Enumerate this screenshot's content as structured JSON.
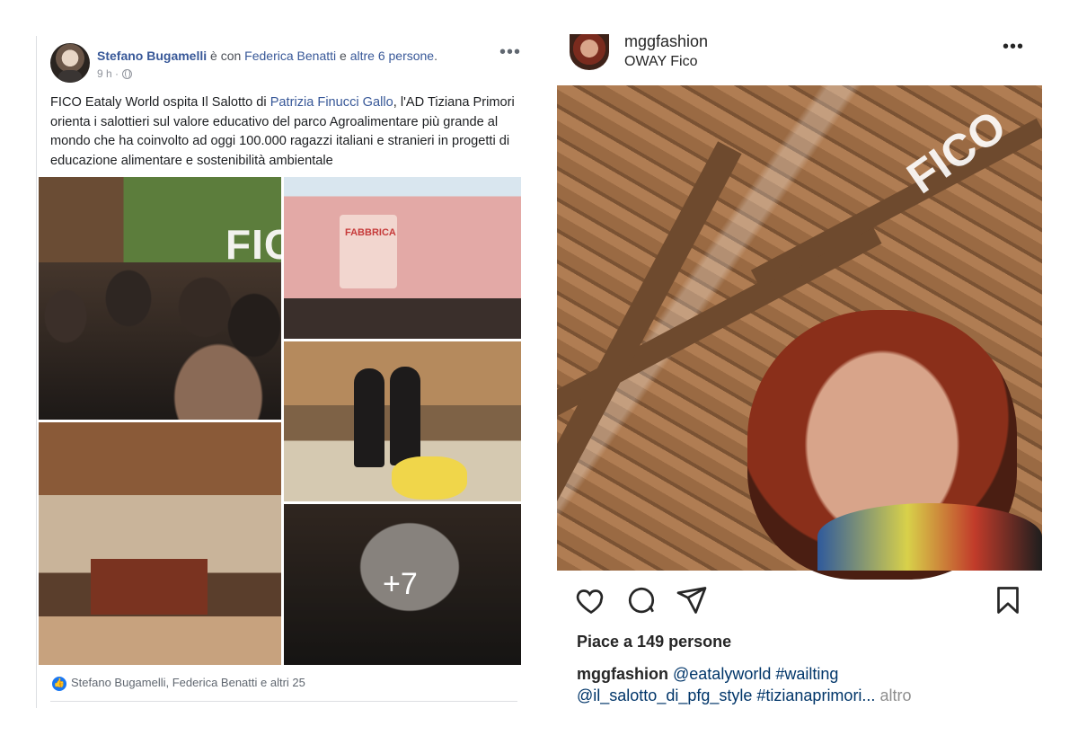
{
  "facebook_post": {
    "author": "Stefano Bugamelli",
    "with_text": "è con",
    "tagged_person": "Federica Benatti",
    "and_text": "e",
    "others_link": "altre 6 persone",
    "period": ".",
    "timestamp": "9 h ·",
    "more_icon": "more-horizontal-icon",
    "text_part1": "FICO Eataly World ospita Il Salotto di ",
    "text_mention": "Patrizia Finucci Gallo",
    "text_part2": ", l'AD Tiziana Primori orienta i salottieri sul valore educativo del parco Agroalimentare più grande al mondo che ha coinvolto ad oggi 100.000 ragazzi italiani e stranieri in progetti di educazione alimentare e sostenibilità ambientale",
    "photo_sign_fico": "FICO",
    "photo_sign_fabbrica": "FABBRICA",
    "more_photos": "+7",
    "reactions_text": "Stefano Bugamelli, Federica Benatti e altri 25"
  },
  "instagram_post": {
    "username": "mggfashion",
    "location": "OWAY Fico",
    "likes": "Piace a 149 persone",
    "caption_user": "mggfashion",
    "caption_tags_line1": "@eatalyworld #wailting",
    "caption_tags_line2": "@il_salotto_di_pfg_style #tizianaprimori...",
    "caption_more": "altro",
    "action_icons": [
      "heart-icon",
      "comment-icon",
      "share-icon",
      "bookmark-icon"
    ]
  },
  "colors": {
    "facebook_link": "#385898",
    "facebook_like": "#1877f2",
    "instagram_text": "#262626"
  }
}
